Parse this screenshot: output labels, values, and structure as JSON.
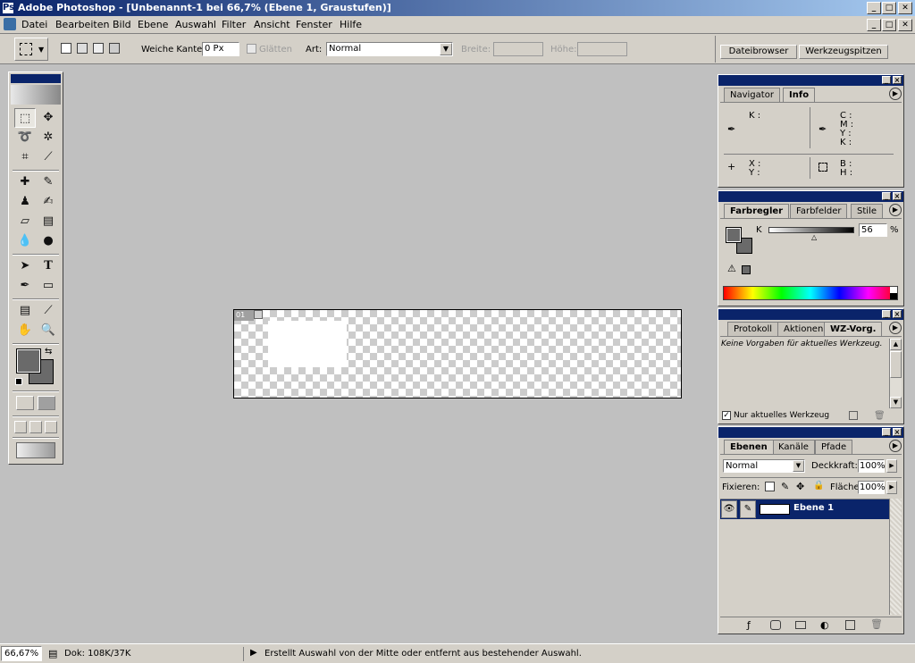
{
  "window": {
    "title": "Adobe Photoshop - [Unbenannt-1 bei 66,7% (Ebene 1, Graustufen)]",
    "min": "_",
    "max": "□",
    "close": "✕"
  },
  "menu": [
    "Datei",
    "Bearbeiten",
    "Bild",
    "Ebene",
    "Auswahl",
    "Filter",
    "Ansicht",
    "Fenster",
    "Hilfe"
  ],
  "options": {
    "feather_label": "Weiche Kante:",
    "feather_value": "0 Px",
    "antialias_label": "Glätten",
    "style_label": "Art:",
    "style_value": "Normal",
    "width_label": "Breite:",
    "height_label": "Höhe:",
    "well_tabs": [
      "Dateibrowser",
      "Werkzeugspitzen"
    ]
  },
  "info_panel": {
    "tabs": [
      "Navigator",
      "Info"
    ],
    "k_label": "K :",
    "cmyk": [
      "C :",
      "M :",
      "Y :",
      "K :"
    ],
    "xy": [
      "X :",
      "Y :"
    ],
    "bh": [
      "B :",
      "H :"
    ]
  },
  "color_panel": {
    "tabs": [
      "Farbregler",
      "Farbfelder",
      "Stile"
    ],
    "channel": "K",
    "value": "56",
    "unit": "%"
  },
  "history_panel": {
    "tabs": [
      "Protokoll",
      "Aktionen",
      "WZ-Vorg."
    ],
    "message": "Keine Vorgaben für aktuelles Werkzeug.",
    "checkbox_label": "Nur aktuelles Werkzeug"
  },
  "layers_panel": {
    "tabs": [
      "Ebenen",
      "Kanäle",
      "Pfade"
    ],
    "blend": "Normal",
    "opacity_label": "Deckkraft:",
    "opacity": "100%",
    "lock_label": "Fixieren:",
    "fill_label": "Fläche",
    "fill": "100%",
    "layer_name": "Ebene 1"
  },
  "document": {
    "tag": "01"
  },
  "status": {
    "zoom": "66,67%",
    "doc": "Dok: 108K/37K",
    "hint": "Erstellt Auswahl von der Mitte oder entfernt aus bestehender Auswahl."
  },
  "colors": {
    "title_start": "#0a246a",
    "title_end": "#a6caf0",
    "chrome": "#d4d0c8",
    "workspace": "#c0c0c0",
    "selection": "#0a246a"
  }
}
